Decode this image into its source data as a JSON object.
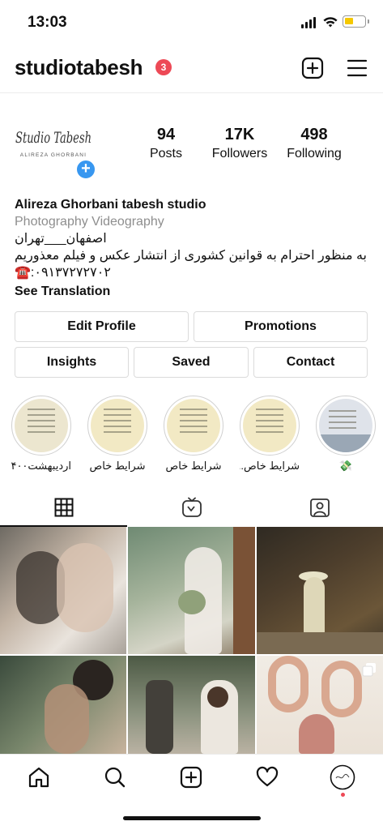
{
  "status_bar": {
    "time": "13:03"
  },
  "header": {
    "username": "studiotabesh",
    "notification_count": "3"
  },
  "profile": {
    "logo_line1": "Studio Tabesh",
    "logo_line2": "ALIREZA GHORBANI",
    "stats": [
      {
        "value": "94",
        "label": "Posts"
      },
      {
        "value": "17K",
        "label": "Followers"
      },
      {
        "value": "498",
        "label": "Following"
      }
    ],
    "bio": {
      "name": "Alireza Ghorbani tabesh studio",
      "category": "Photography Videography",
      "line1": "اصفهان___تهران",
      "line2": "به منظور احترام به قوانین کشوری از انتشار عکس و فیلم معذوریم",
      "line3": "☎️:۰۹۱۳۷۲۷۲۷۰۲",
      "translate": "See Translation"
    }
  },
  "buttons": {
    "edit_profile": "Edit Profile",
    "promotions": "Promotions",
    "insights": "Insights",
    "saved": "Saved",
    "contact": "Contact"
  },
  "highlights": [
    {
      "label": "اردیبهشت۱۴۰۰"
    },
    {
      "label": "شرایط خاص"
    },
    {
      "label": "شرایط خاص"
    },
    {
      "label": "شرایط خاص..."
    },
    {
      "label": "💸"
    }
  ],
  "tabs": [
    "grid-tab",
    "igtv-tab",
    "tagged-tab"
  ],
  "grid_posts": [
    {
      "description": "couple embrace"
    },
    {
      "description": "bride with bouquet"
    },
    {
      "description": "woman in hat"
    },
    {
      "description": "couple kiss"
    },
    {
      "description": "bride and groom"
    },
    {
      "description": "23 balloons"
    }
  ],
  "colors": {
    "badge": "#ed4956",
    "add_button": "#3897f0",
    "border": "#dbdbdb",
    "secondary_text": "#8e8e8e"
  }
}
